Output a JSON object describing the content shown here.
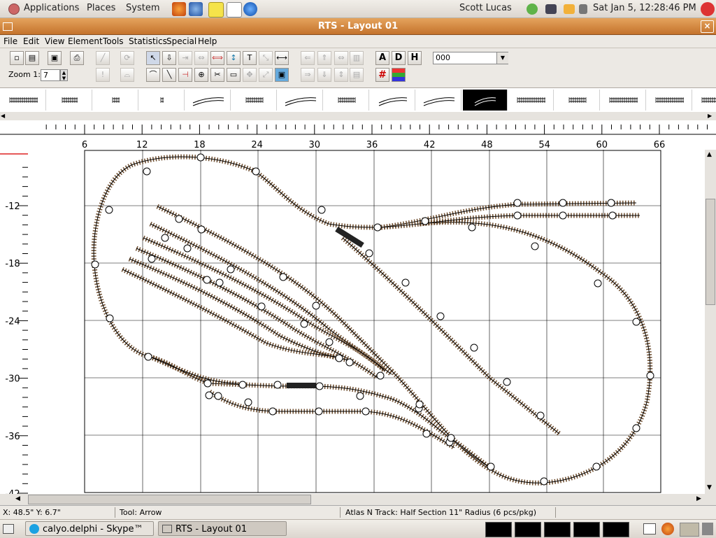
{
  "panel": {
    "menus": [
      "Applications",
      "Places",
      "System"
    ],
    "user": "Scott Lucas",
    "clock": "Sat Jan  5, 12:28:46 PM"
  },
  "window": {
    "title": "RTS - Layout 01",
    "close": "×"
  },
  "menubar": [
    "File",
    "Edit",
    "View",
    "Element",
    "Tools",
    "Statistics",
    "Special",
    "Help"
  ],
  "toolbar": {
    "zoom_label": "Zoom 1:",
    "zoom_value": "7",
    "combo_value": "000",
    "letter_buttons": [
      "A",
      "D",
      "H"
    ],
    "text_tool": "T"
  },
  "ruler": {
    "h_labels": [
      "6",
      "12",
      "18",
      "24",
      "30",
      "36",
      "42",
      "48",
      "54",
      "60",
      "66"
    ],
    "v_labels": [
      "-12",
      "-18",
      "-24",
      "-30",
      "-36",
      "-42"
    ]
  },
  "status": {
    "coords": "X: 48.5\"    Y: 6.7\"",
    "tool": "Tool: Arrow",
    "element": "Atlas N Track: Half Section 11\" Radius (6 pcs/pkg)"
  },
  "taskbar": {
    "tasks": [
      "calyo.delphi - Skype™",
      "RTS - Layout 01"
    ]
  }
}
